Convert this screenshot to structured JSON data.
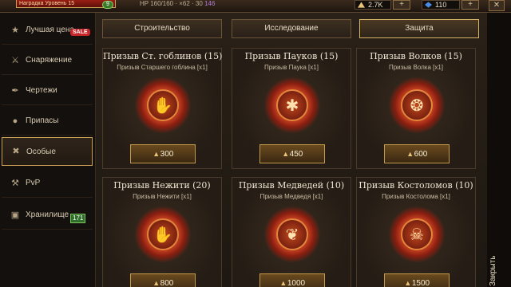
{
  "topbar": {
    "quest_text": "Наградка Уровень 15",
    "level": "9",
    "stats_text": "HP 160/160 · ×62 · ",
    "stat_a": "30",
    "stat_b": "146",
    "gold": "2.7K",
    "gems": "110",
    "plus": "+",
    "close": "✕"
  },
  "sidebar": {
    "items": [
      {
        "label": "Лучшая цена",
        "icon": "star-icon"
      },
      {
        "label": "Снаряжение",
        "icon": "crossed-swords-icon"
      },
      {
        "label": "Чертежи",
        "icon": "quill-icon"
      },
      {
        "label": "Припасы",
        "icon": "meat-icon"
      },
      {
        "label": "Особые",
        "icon": "tools-icon"
      },
      {
        "label": "PvP",
        "icon": "sword-icon"
      },
      {
        "label": "Хранилище",
        "icon": "chest-icon"
      }
    ],
    "sale_badge": "SALE",
    "storage_count": "171"
  },
  "tabs": [
    {
      "label": "Строительство",
      "active": false
    },
    {
      "label": "Исследование",
      "active": false
    },
    {
      "label": "Защита",
      "active": true
    }
  ],
  "cards": [
    {
      "title": "Призыв Ст. гоблинов (15)",
      "subtitle": "Призыв Старшего гоблина [x1]",
      "price": "300",
      "icon": "goblin-claw-icon"
    },
    {
      "title": "Призыв Пауков (15)",
      "subtitle": "Призыв Паука [x1]",
      "price": "450",
      "icon": "spider-icon"
    },
    {
      "title": "Призыв Волков (15)",
      "subtitle": "Призыв Волка [x1]",
      "price": "600",
      "icon": "wolf-icon"
    },
    {
      "title": "Призыв Нежити (20)",
      "subtitle": "Призыв Нежити [x1]",
      "price": "800",
      "icon": "bone-hand-icon"
    },
    {
      "title": "Призыв Медведей (10)",
      "subtitle": "Призыв Медведя [x1]",
      "price": "1000",
      "icon": "bear-paw-icon"
    },
    {
      "title": "Призыв Костоломов (10)",
      "subtitle": "Призыв Костолома [x1]",
      "price": "1500",
      "icon": "skull-icon"
    }
  ],
  "close_label": "Закрыть",
  "colors": {
    "accent_gold": "#c9a055",
    "sale_red": "#c8242a",
    "count_green": "#2f6e2a"
  }
}
